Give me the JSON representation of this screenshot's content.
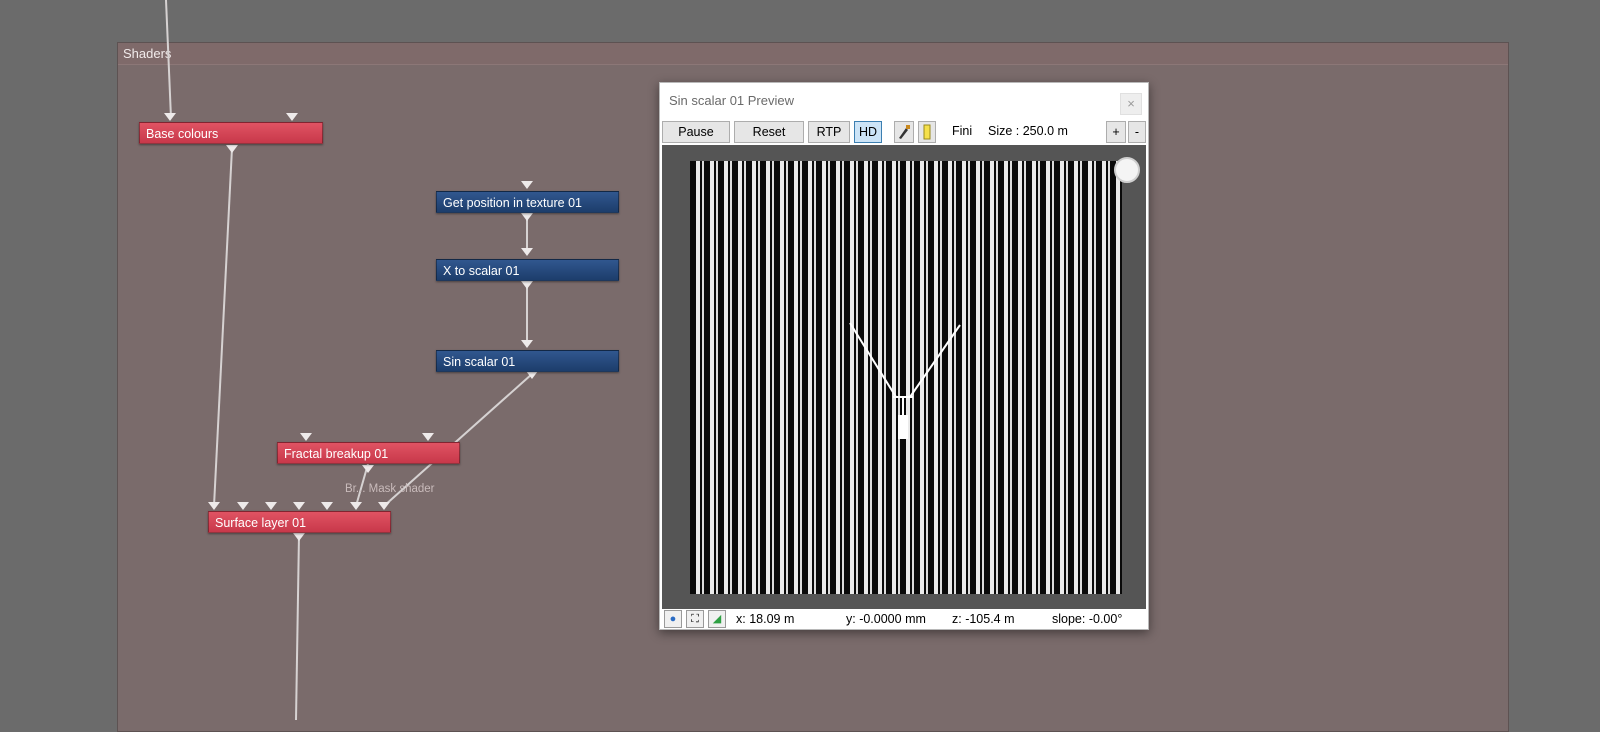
{
  "panel": {
    "title": "Shaders"
  },
  "nodes": {
    "base_colours": "Base colours",
    "get_position": "Get position in texture 01",
    "x_to_scalar": "X to scalar 01",
    "sin_scalar": "Sin scalar 01",
    "fractal_breakup": "Fractal breakup 01",
    "surface_layer": "Surface layer 01"
  },
  "port_label": "Br... Mask shader",
  "preview": {
    "title": "Sin scalar 01 Preview",
    "close": "×",
    "toolbar": {
      "pause": "Pause",
      "reset": "Reset",
      "rtp": "RTP",
      "hd": "HD",
      "fini": "Fini",
      "size": "Size :  250.0 m",
      "plus": "+",
      "minus": "-"
    },
    "status": {
      "x": "x: 18.09 m",
      "y": "y: -0.0000 mm",
      "z": "z: -105.4 m",
      "slope": "slope: -0.00°"
    }
  },
  "icons": {
    "eye": "eye-icon",
    "fullscreen": "fullscreen-icon",
    "lighting": "lighting-icon",
    "paint": "paint-icon",
    "light": "light-icon"
  },
  "colors": {
    "node_red": "#d3404f",
    "node_blue": "#264a7d",
    "panel_bg": "#7a6b6b",
    "wire": "#d6d2d2"
  }
}
